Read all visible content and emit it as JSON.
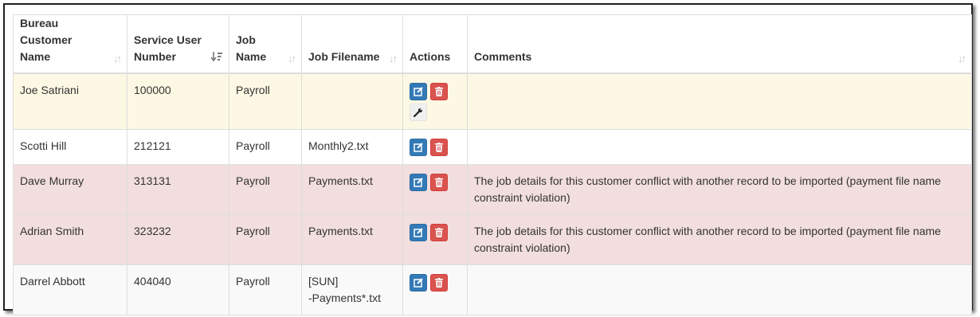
{
  "table": {
    "headers": [
      {
        "label": "Bureau Customer Name",
        "sort": "unsorted"
      },
      {
        "label": "Service User Number",
        "sort": "descending"
      },
      {
        "label": "Job Name",
        "sort": "unsorted"
      },
      {
        "label": "Job Filename",
        "sort": "unsorted"
      },
      {
        "label": "Actions",
        "sort": "none"
      },
      {
        "label": "Comments",
        "sort": "unsorted"
      }
    ],
    "rows": [
      {
        "status": "warning",
        "customer": "Joe Satriani",
        "sun": "100000",
        "job": "Payroll",
        "filename": "",
        "comment": ""
      },
      {
        "status": "normal",
        "customer": "Scotti Hill",
        "sun": "212121",
        "job": "Payroll",
        "filename": "Monthly2.txt",
        "comment": ""
      },
      {
        "status": "danger",
        "customer": "Dave Murray",
        "sun": "313131",
        "job": "Payroll",
        "filename": "Payments.txt",
        "comment": "The job details for this customer conflict with another record to be imported (payment file name constraint violation)"
      },
      {
        "status": "danger",
        "customer": "Adrian Smith",
        "sun": "323232",
        "job": "Payroll",
        "filename": "Payments.txt",
        "comment": "The job details for this customer conflict with another record to be imported (payment file name constraint violation)"
      },
      {
        "status": "normal",
        "customer": "Darrel Abbott",
        "sun": "404040",
        "job": "Payroll",
        "filename": "[SUN]\n-Payments*.txt",
        "comment": ""
      }
    ],
    "action_icons": [
      "edit-icon",
      "trash-icon",
      "wrench-icon"
    ]
  },
  "colors": {
    "warning_row": "#fcf8e3",
    "danger_row": "#f2dede",
    "edit_button": "#337ab7",
    "delete_button": "#d9534f"
  }
}
